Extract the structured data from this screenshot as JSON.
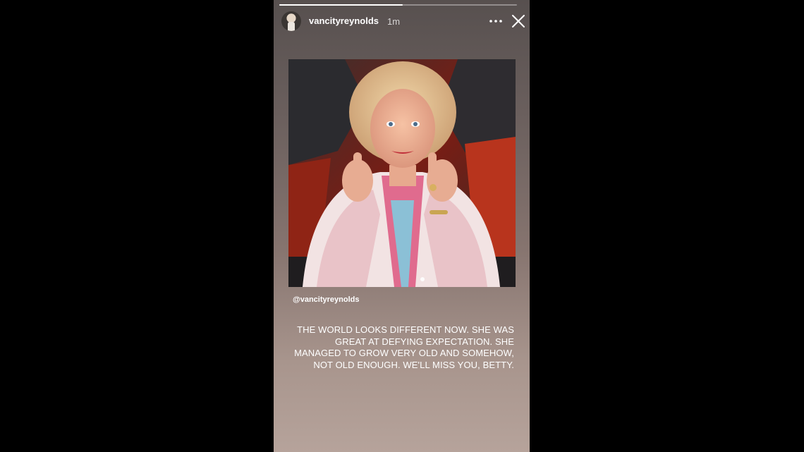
{
  "story": {
    "username": "vancityreynolds",
    "timestamp": "1m",
    "progress": 0.52,
    "mention": "@vancityreynolds",
    "caption": "THE WORLD LOOKS DIFFERENT NOW. SHE WAS GREAT AT DEFYING EXPECTATION. SHE MANAGED TO GROW VERY OLD AND SOMEHOW, NOT OLD ENOUGH. WE'LL MISS YOU, BETTY."
  },
  "icons": {
    "more": "more-horizontal-icon",
    "close": "close-icon",
    "avatar": "profile-avatar"
  },
  "colors": {
    "background": "#000000",
    "text": "#ffffff"
  }
}
